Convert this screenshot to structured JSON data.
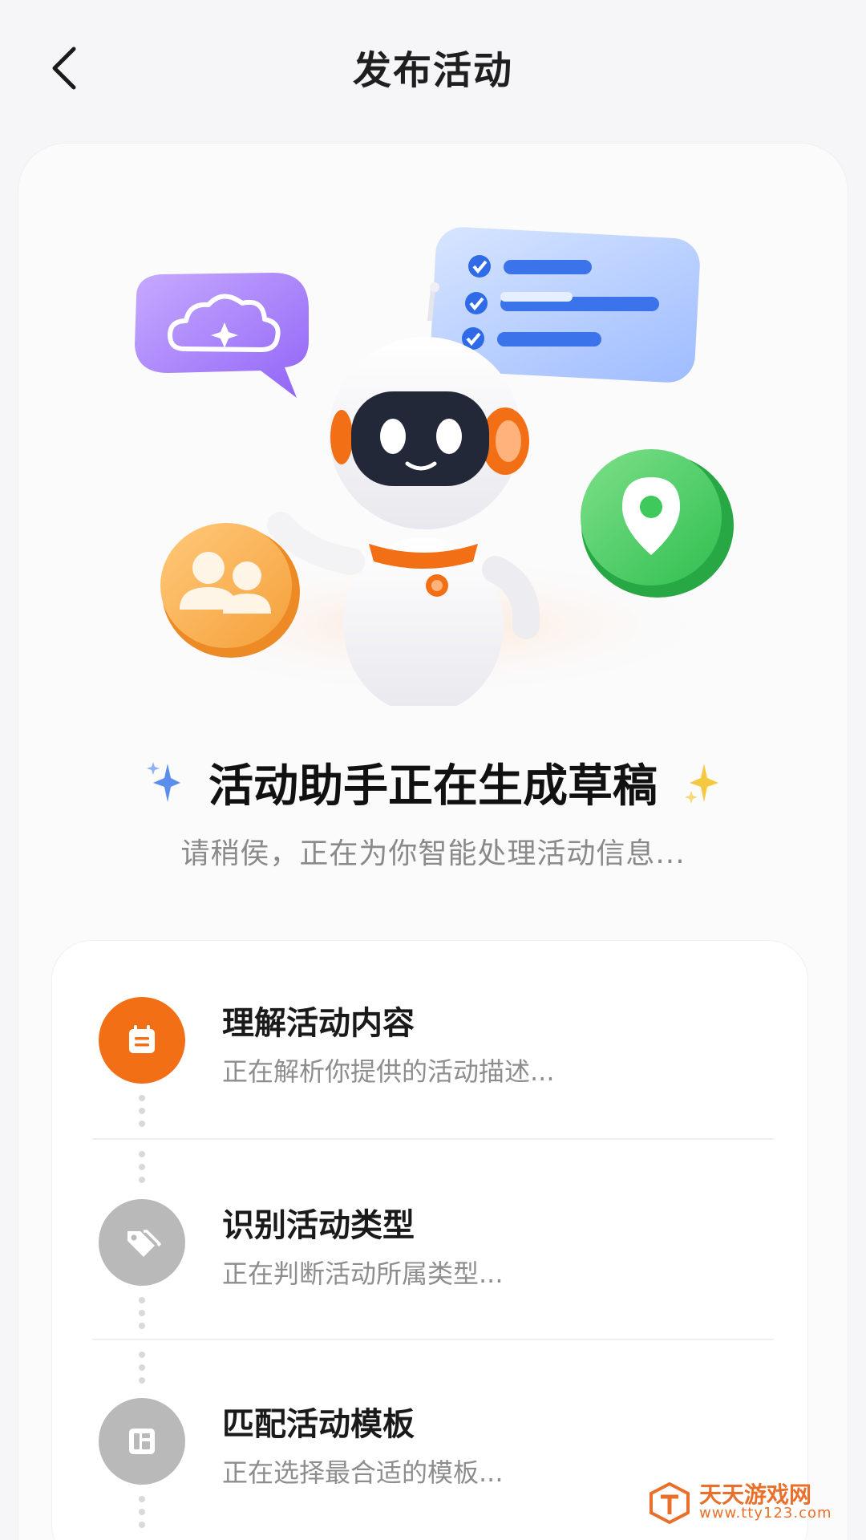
{
  "header": {
    "title": "发布活动",
    "back_icon": "chevron-left-icon"
  },
  "hero": {
    "title": "活动助手正在生成草稿",
    "subtitle": "请稍侯，正在为你智能处理活动信息...",
    "illustration": [
      "robot",
      "cloud-chat-bubble-icon",
      "checklist-card-icon",
      "people-icon",
      "location-pin-icon"
    ]
  },
  "steps": [
    {
      "title": "理解活动内容",
      "desc": "正在解析你提供的活动描述...",
      "icon": "calendar-icon",
      "state": "active",
      "color": "#f36f16"
    },
    {
      "title": "识别活动类型",
      "desc": "正在判断活动所属类型...",
      "icon": "tags-icon",
      "state": "pending",
      "color": "#b9b9b9"
    },
    {
      "title": "匹配活动模板",
      "desc": "正在选择最合适的模板...",
      "icon": "template-layout-icon",
      "state": "pending",
      "color": "#b9b9b9"
    }
  ],
  "watermark": {
    "name": "天天游戏网",
    "url": "www.tty123.com"
  },
  "colors": {
    "accent": "#f36f16",
    "pending": "#b9b9b9",
    "sparkle_blue": "#5b8def",
    "sparkle_yellow": "#f5c842"
  }
}
